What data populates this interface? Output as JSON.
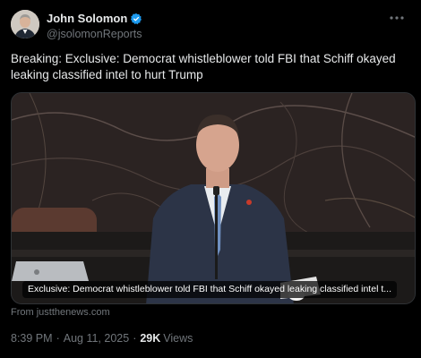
{
  "author": {
    "display_name": "John Solomon",
    "handle": "@jsolomonReports",
    "verified": true,
    "verified_color": "#1d9bf0"
  },
  "more_icon": "three-dots-icon",
  "tweet_text": "Breaking: Exclusive: Democrat whistleblower told FBI that Schiff okayed leaking classified intel to hurt Trump",
  "media": {
    "caption": "Exclusive: Democrat whistleblower told FBI that Schiff okayed leaking classified intel t...",
    "source": "From justthenews.com"
  },
  "meta": {
    "time": "8:39 PM",
    "separator": "·",
    "date": "Aug 11, 2025",
    "views_count": "29K",
    "views_label": "Views"
  }
}
